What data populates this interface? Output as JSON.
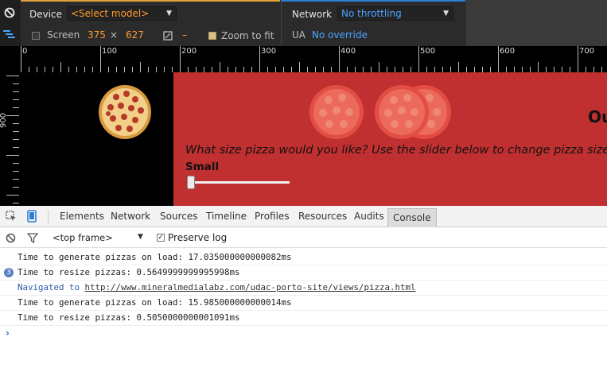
{
  "emulation": {
    "device_label": "Device",
    "device_select": "<Select model>",
    "network_label": "Network",
    "network_select": "No throttling",
    "screen_label": "Screen",
    "screen_width": "375",
    "times": "×",
    "screen_height": "627",
    "dpr_placeholder": "–",
    "zoom_label": "Zoom to fit",
    "ua_label": "UA",
    "ua_value": "No override"
  },
  "ruler": {
    "h_numbers": [
      "0",
      "100",
      "200",
      "300",
      "400",
      "500",
      "600",
      "700"
    ],
    "v_number": "900"
  },
  "page": {
    "heading_fragment": "Ou",
    "question": "What size pizza would you like? Use the slider below to change pizza size",
    "size_label": "Small",
    "slider_value": 0
  },
  "devtools": {
    "tabs": [
      "Elements",
      "Network",
      "Sources",
      "Timeline",
      "Profiles",
      "Resources",
      "Audits",
      "Console"
    ],
    "frame_select": "<top frame>",
    "preserve_log_label": "Preserve log",
    "log": [
      {
        "text": "Time to generate pizzas on load: 17.035000000000082ms",
        "badge": ""
      },
      {
        "text": "Time to resize pizzas: 0.5649999999995998ms",
        "badge": "3"
      },
      {
        "text_prefix": "Navigated to ",
        "link": "http://www.mineralmedialabz.com/udac-porto-site/views/pizza.html"
      },
      {
        "text": "Time to generate pizzas on load: 15.985000000000014ms",
        "badge": ""
      },
      {
        "text": "Time to resize pizzas: 0.5050000000001091ms",
        "badge": ""
      }
    ],
    "prompt": "›"
  },
  "colors": {
    "page_bg": "#c13030",
    "device_accent": "#e0a23a",
    "network_accent": "#2f7fd3",
    "link_blue": "#4aa3ff"
  }
}
